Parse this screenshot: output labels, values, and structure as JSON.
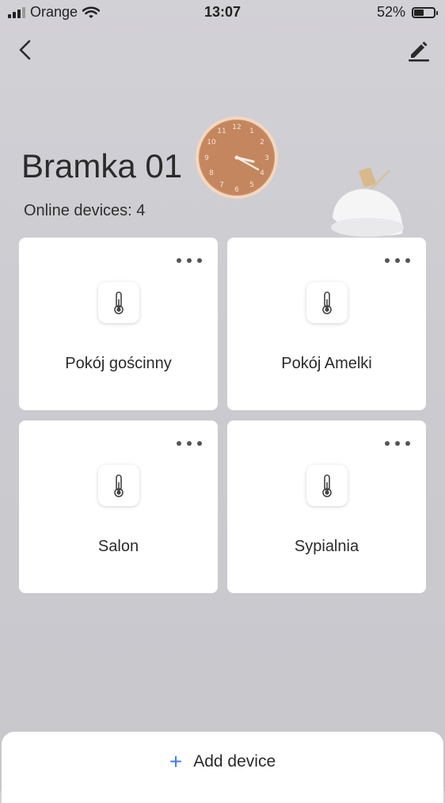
{
  "status_bar": {
    "carrier": "Orange",
    "time": "13:07",
    "battery_percent": "52%",
    "battery_level": 0.52
  },
  "nav": {
    "back_icon": "chevron-left-icon",
    "edit_icon": "pencil-icon"
  },
  "header": {
    "title": "Bramka 01",
    "online_devices": "Online devices: 4"
  },
  "devices": [
    {
      "name": "Pokój gościnny",
      "icon": "thermometer-icon"
    },
    {
      "name": "Pokój Amelki",
      "icon": "thermometer-icon"
    },
    {
      "name": "Salon",
      "icon": "thermometer-icon"
    },
    {
      "name": "Sypialnia",
      "icon": "thermometer-icon"
    }
  ],
  "footer": {
    "add_device_label": "Add device",
    "add_icon": "plus-icon",
    "accent_color": "#3d7df5"
  }
}
